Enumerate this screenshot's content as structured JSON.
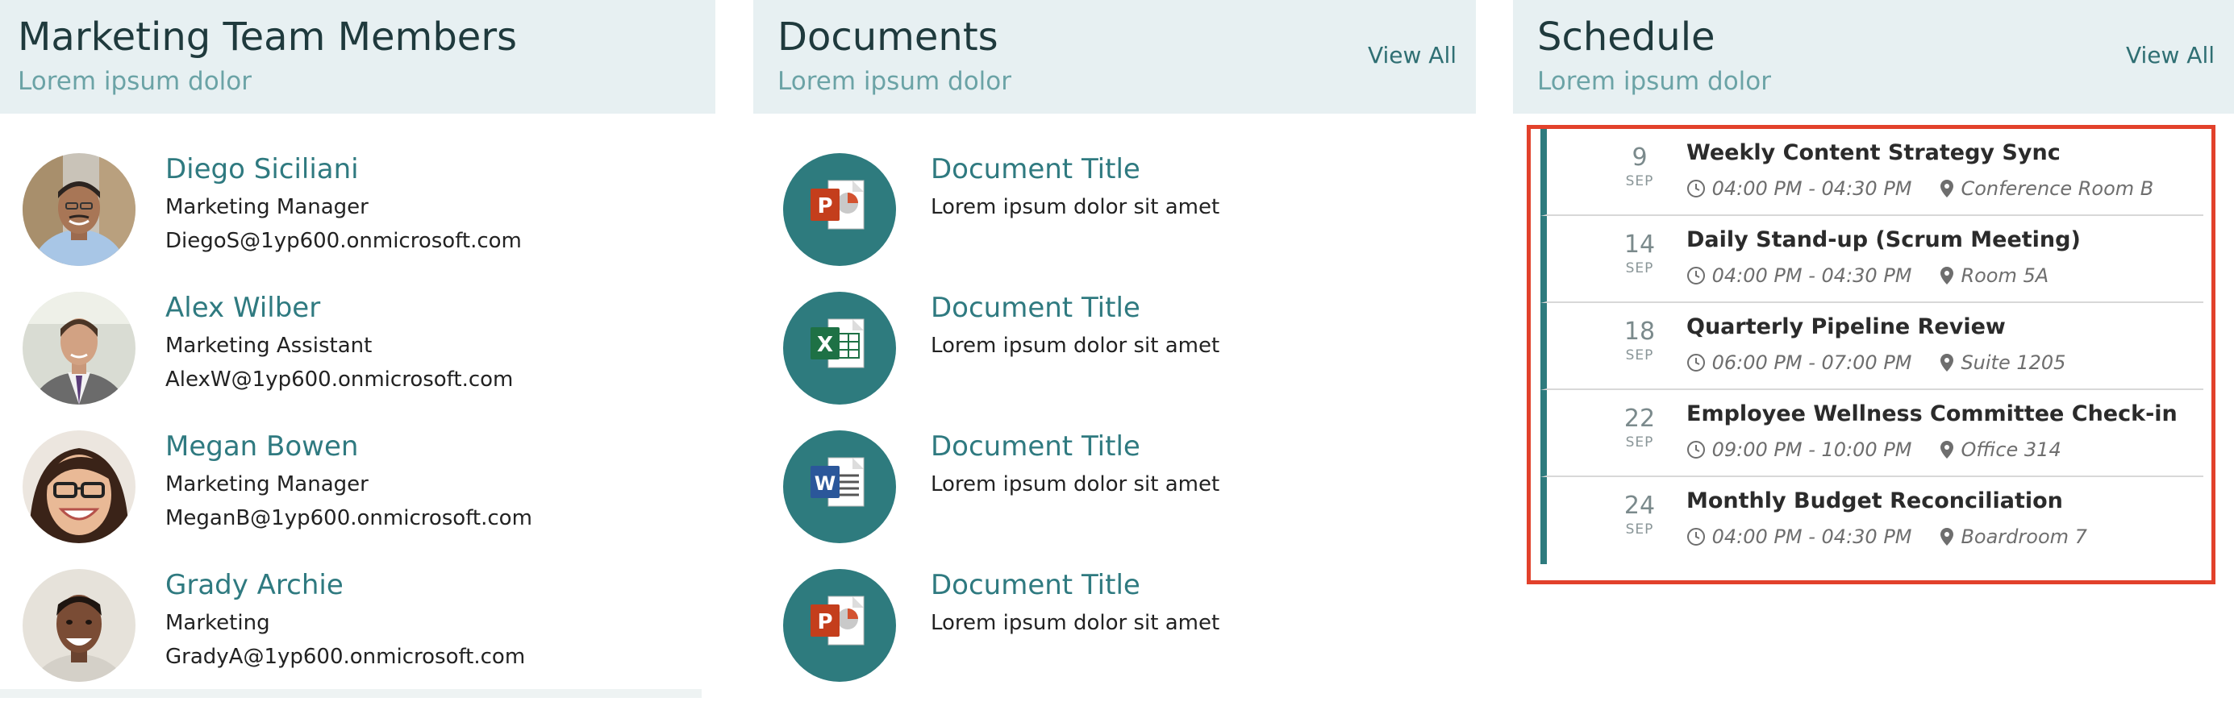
{
  "members": {
    "title": "Marketing Team Members",
    "subtitle": "Lorem ipsum dolor",
    "items": [
      {
        "name": "Diego Siciliani",
        "role": "Marketing Manager",
        "email": "DiegoS@1yp600.onmicrosoft.com",
        "avatar": "avatar-diego"
      },
      {
        "name": "Alex Wilber",
        "role": "Marketing Assistant",
        "email": "AlexW@1yp600.onmicrosoft.com",
        "avatar": "avatar-alex"
      },
      {
        "name": "Megan Bowen",
        "role": "Marketing Manager",
        "email": "MeganB@1yp600.onmicrosoft.com",
        "avatar": "avatar-megan"
      },
      {
        "name": "Grady Archie",
        "role": "Marketing",
        "email": "GradyA@1yp600.onmicrosoft.com",
        "avatar": "avatar-grady"
      }
    ]
  },
  "documents": {
    "title": "Documents",
    "subtitle": "Lorem ipsum dolor",
    "view_all": "View All",
    "items": [
      {
        "title": "Document Title",
        "desc": "Lorem ipsum dolor sit amet",
        "icon": "powerpoint-icon"
      },
      {
        "title": "Document Title",
        "desc": "Lorem ipsum dolor sit amet",
        "icon": "excel-icon"
      },
      {
        "title": "Document Title",
        "desc": "Lorem ipsum dolor sit amet",
        "icon": "word-icon"
      },
      {
        "title": "Document Title",
        "desc": "Lorem ipsum dolor sit amet",
        "icon": "powerpoint-icon"
      }
    ]
  },
  "schedule": {
    "title": "Schedule",
    "subtitle": "Lorem ipsum dolor",
    "view_all": "View All",
    "events": [
      {
        "day": "9",
        "month": "SEP",
        "title": "Weekly Content Strategy Sync",
        "time": "04:00 PM - 04:30 PM",
        "location": "Conference Room B"
      },
      {
        "day": "14",
        "month": "SEP",
        "title": "Daily Stand-up (Scrum Meeting)",
        "time": "04:00 PM - 04:30 PM",
        "location": "Room 5A"
      },
      {
        "day": "18",
        "month": "SEP",
        "title": "Quarterly Pipeline Review",
        "time": "06:00 PM - 07:00 PM",
        "location": "Suite 1205"
      },
      {
        "day": "22",
        "month": "SEP",
        "title": "Employee Wellness Committee Check-in",
        "time": "09:00 PM - 10:00 PM",
        "location": "Office 314"
      },
      {
        "day": "24",
        "month": "SEP",
        "title": "Monthly Budget Reconciliation",
        "time": "04:00 PM - 04:30 PM",
        "location": "Boardroom 7"
      }
    ]
  },
  "colors": {
    "accent": "#2e7b7e",
    "header_bg": "#e7f0f2",
    "highlight_border": "#e2412b",
    "link": "#2f7a80"
  }
}
